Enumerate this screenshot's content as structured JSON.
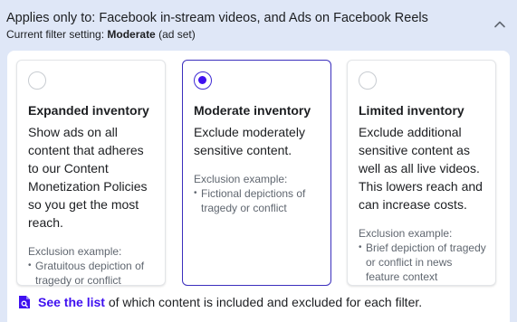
{
  "header": {
    "title": "Applies only to: Facebook in-stream videos, and Ads on Facebook Reels",
    "filter_prefix": "Current filter setting:",
    "filter_value": "Moderate",
    "filter_suffix": "(ad set)"
  },
  "options": [
    {
      "title": "Expanded inventory",
      "description": "Show ads on all content that adheres to our Content Monetization Policies so you get the most reach.",
      "example_label": "Exclusion example:",
      "examples": [
        "Gratuitous depiction of tragedy or conflict"
      ],
      "selected": false
    },
    {
      "title": "Moderate inventory",
      "description": "Exclude moderately sensitive content.",
      "example_label": "Exclusion example:",
      "examples": [
        "Fictional depictions of tragedy or conflict"
      ],
      "selected": true
    },
    {
      "title": "Limited inventory",
      "description": "Exclude additional sensitive content as well as all live videos. This lowers reach and can increase costs.",
      "example_label": "Exclusion example:",
      "examples": [
        "Brief depiction of tragedy or conflict in news feature context"
      ],
      "selected": false
    }
  ],
  "footer": {
    "link_text": "See the list",
    "rest_text": "of which content is included and excluded for each filter."
  },
  "colors": {
    "accent": "#3f10f0",
    "selected_border": "#3b2fbd",
    "background": "#dfe7f7"
  },
  "icons": {
    "collapse": "chevron-up-icon",
    "document": "document-search-icon"
  }
}
